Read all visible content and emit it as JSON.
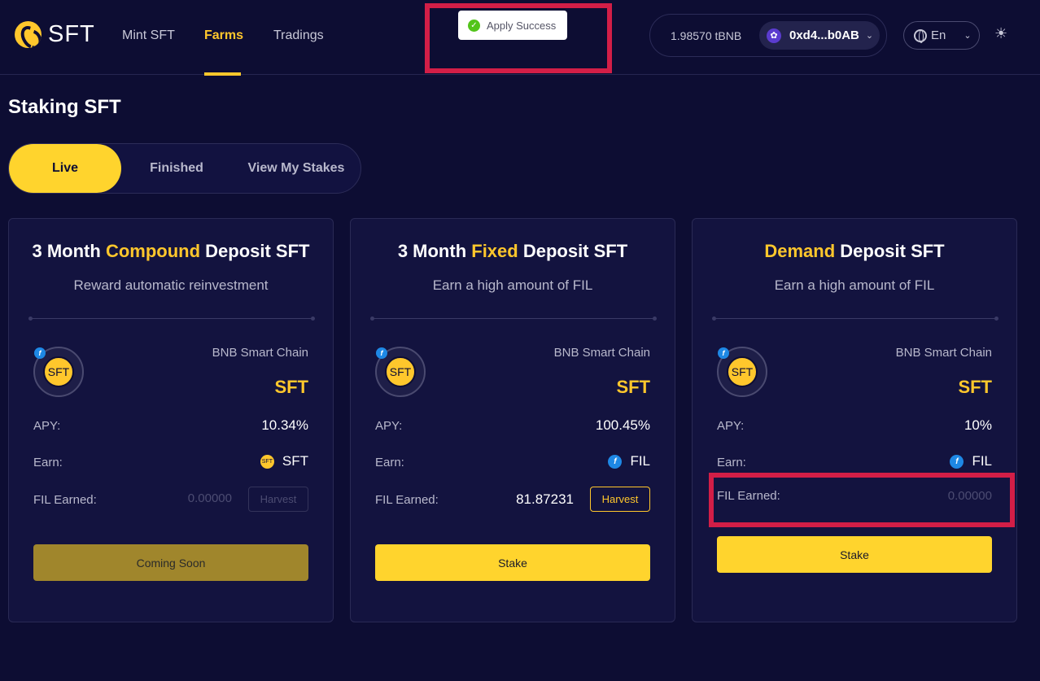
{
  "header": {
    "logo_text": "SFT",
    "nav": [
      {
        "label": "Mint SFT"
      },
      {
        "label": "Farms"
      },
      {
        "label": "Tradings"
      }
    ],
    "toast": "Apply Success",
    "balance": "1.98570 tBNB",
    "address": "0xd4...b0AB",
    "language": "En"
  },
  "page": {
    "title": "Staking SFT",
    "tabs": [
      "Live",
      "Finished",
      "View My Stakes"
    ]
  },
  "labels": {
    "apy": "APY:",
    "earn": "Earn:",
    "earned": "FIL Earned:",
    "harvest": "Harvest"
  },
  "cards": [
    {
      "title_pre": "3 Month ",
      "title_hl": "Compound",
      "title_post": " Deposit SFT",
      "subtitle": "Reward automatic reinvestment",
      "chain": "BNB Smart Chain",
      "token": "SFT",
      "coin_text": "SFT",
      "apy": "10.34%",
      "earn_coin": "SFT",
      "earn": "SFT",
      "earned": "0.00000",
      "action": "Coming Soon"
    },
    {
      "title_pre": "3 Month ",
      "title_hl": "Fixed",
      "title_post": " Deposit SFT",
      "subtitle": "Earn a high amount of FIL",
      "chain": "BNB Smart Chain",
      "token": "SFT",
      "coin_text": "SFT",
      "apy": "100.45%",
      "earn_coin": "f",
      "earn": "FIL",
      "earned": "81.87231",
      "action": "Stake"
    },
    {
      "title_pre": "",
      "title_hl": "Demand",
      "title_post": " Deposit SFT",
      "subtitle": "Earn a high amount of FIL",
      "chain": "BNB Smart Chain",
      "token": "SFT",
      "coin_text": "SFT",
      "apy": "10%",
      "earn_coin": "f",
      "earn": "FIL",
      "earned": "0.00000",
      "action": "Stake"
    }
  ],
  "colors": {
    "background": "#0d0d33",
    "accent": "#ffc72c",
    "highlight": "#d21e47"
  }
}
